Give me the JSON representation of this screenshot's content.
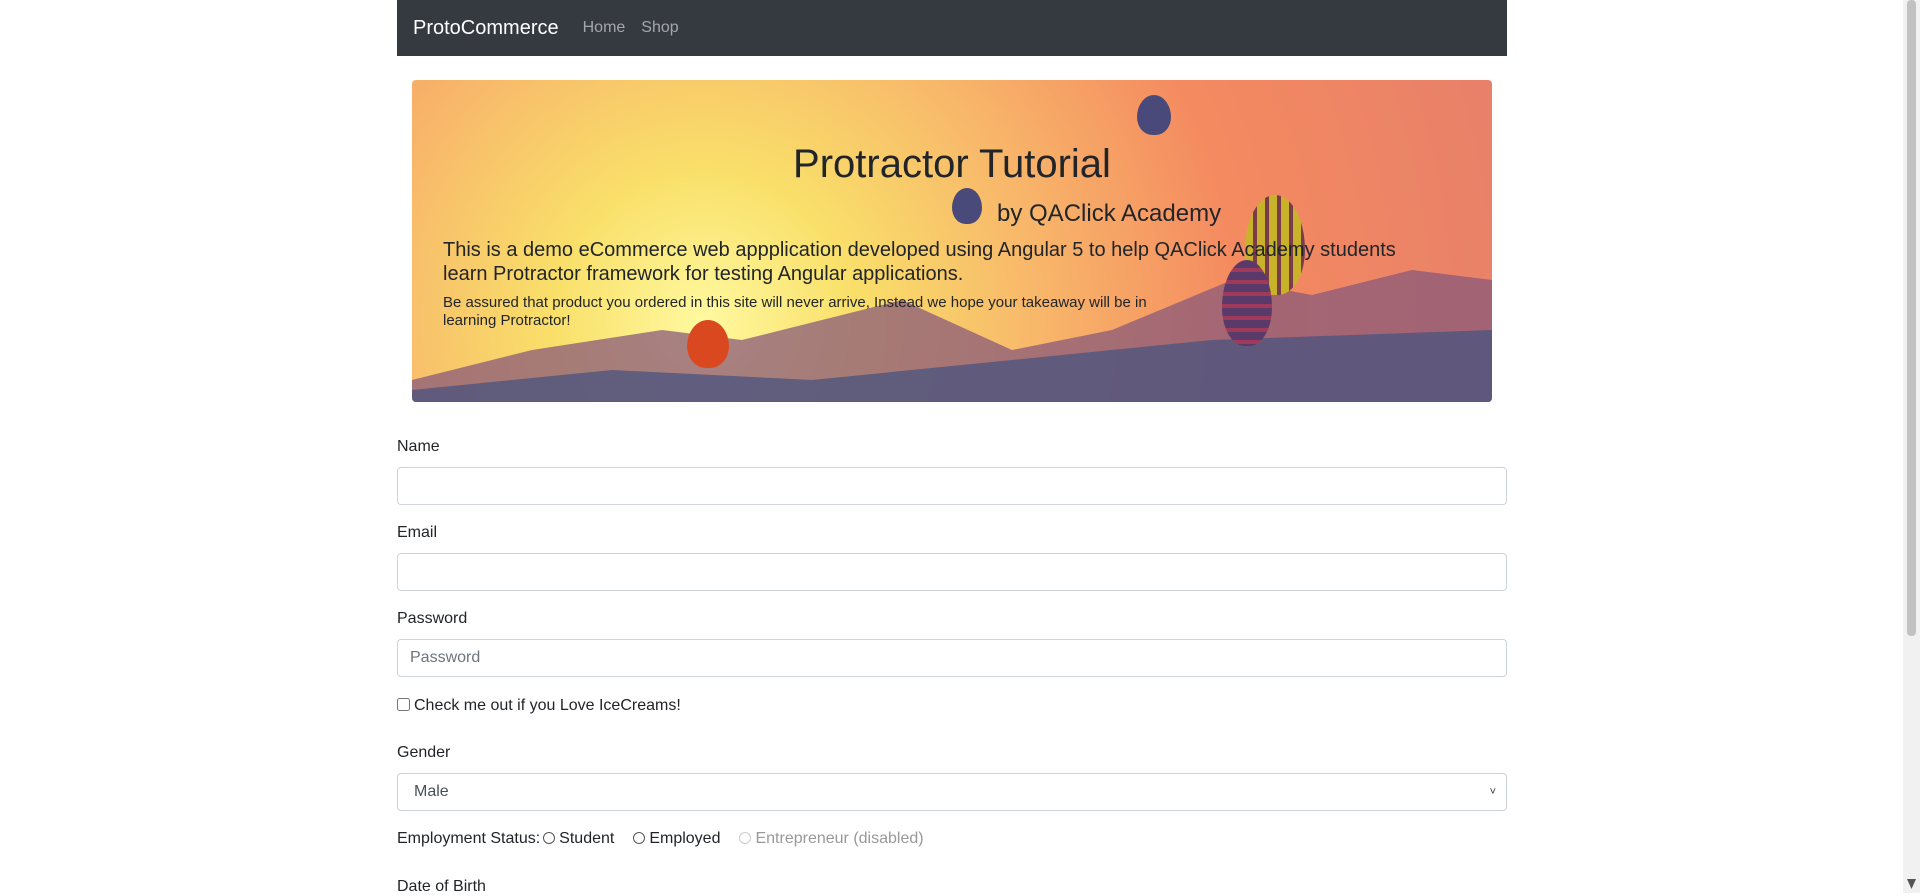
{
  "navbar": {
    "brand": "ProtoCommerce",
    "links": [
      "Home",
      "Shop"
    ]
  },
  "hero": {
    "title": "Protractor Tutorial",
    "subtitle": "by QAClick Academy",
    "lead": "This is a demo eCommerce web appplication developed using Angular 5 to help QAClick Academy students learn Protractor framework for testing Angular applications.",
    "note": "Be assured that product you ordered in this site will never arrive, Instead we hope your takeaway will be in learning Protractor!"
  },
  "form": {
    "name_label": "Name",
    "name_value": "",
    "email_label": "Email",
    "email_value": "",
    "password_label": "Password",
    "password_placeholder": "Password",
    "checkbox_label": "Check me out if you Love IceCreams!",
    "gender_label": "Gender",
    "gender_value": "Male",
    "employment_label": "Employment Status:",
    "employment_options": [
      "Student",
      "Employed",
      "Entrepreneur (disabled)"
    ],
    "dob_label": "Date of Birth"
  }
}
